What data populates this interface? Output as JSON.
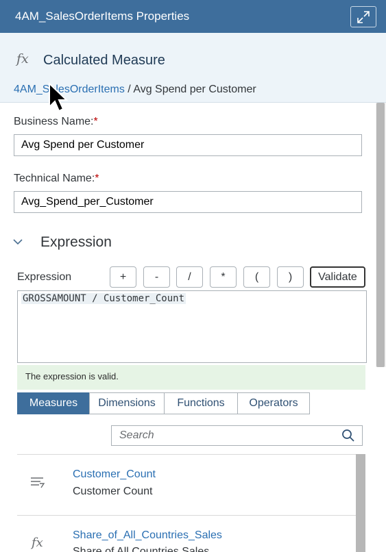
{
  "panel": {
    "title": "4AM_SalesOrderItems Properties",
    "expand_icon": "expand-icon"
  },
  "header": {
    "icon": "fx-icon",
    "object_type": "Calculated Measure",
    "breadcrumb_link": "4AM_SalesOrderItems",
    "breadcrumb_sep": "/",
    "breadcrumb_current": "Avg Spend per Customer"
  },
  "form": {
    "business_name_label": "Business Name:",
    "business_name_value": "Avg Spend per Customer",
    "technical_name_label": "Technical Name:",
    "technical_name_value": "Avg_Spend_per_Customer",
    "required_marker": "*"
  },
  "expression": {
    "section_title": "Expression",
    "field_label": "Expression",
    "operators": [
      "+",
      "-",
      "/",
      "*",
      "(",
      ")"
    ],
    "validate_label": "Validate",
    "text": "GROSSAMOUNT / Customer_Count",
    "status_message": "The expression is valid."
  },
  "tabs": [
    "Measures",
    "Dimensions",
    "Functions",
    "Operators"
  ],
  "search": {
    "placeholder": "Search"
  },
  "items": [
    {
      "name": "Customer_Count",
      "desc": "Customer Count",
      "icon": "measure-icon"
    },
    {
      "name": "Share_of_All_Countries_Sales",
      "desc": "Share of All Countries Sales",
      "icon": "fx-icon"
    }
  ],
  "colors": {
    "accent": "#3e6e9c",
    "header_bg": "#edf4f9",
    "link": "#2a6fb2",
    "valid_bg": "#e6f4e5",
    "required": "#bb0000"
  }
}
